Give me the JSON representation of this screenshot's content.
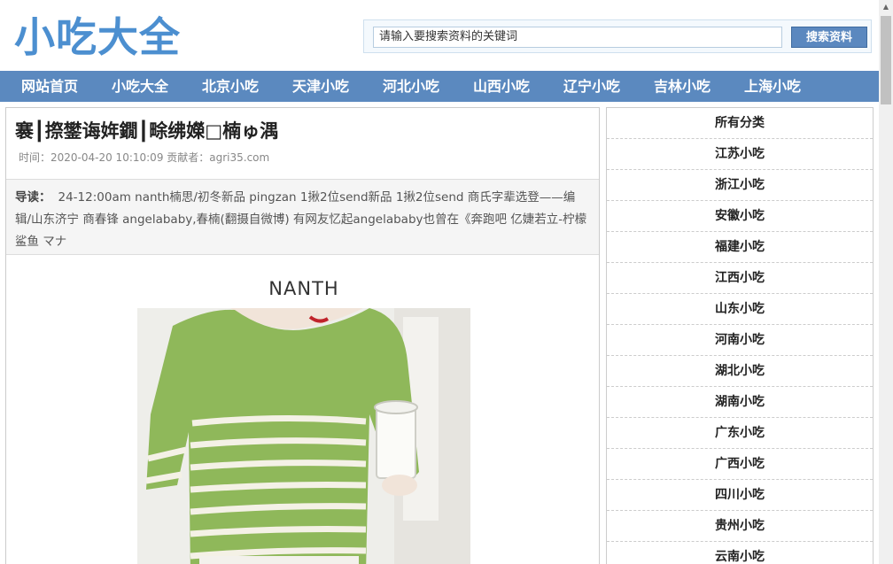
{
  "header": {
    "logo": "小吃大全",
    "search_placeholder": "请输入要搜索资料的关键词",
    "search_button": "搜索资料"
  },
  "nav": [
    "网站首页",
    "小吃大全",
    "北京小吃",
    "天津小吃",
    "河北小吃",
    "山西小吃",
    "辽宁小吃",
    "吉林小吃",
    "上海小吃"
  ],
  "article": {
    "title": "褰┃摖鐢诲姩鐗┃畭绋嬫□楠ゅ湡",
    "meta": "时间：2020-04-20 10:10:09 贡献者：agri35.com",
    "summary_label": "导读：",
    "summary": "24-12:00am nanth楠思/初冬新品 pingzan 1揪2位send新品 1揪2位send 商氏字辈选登——编辑/山东济宁 商春锋 angelababy,春楠(翻摄自微博) 有网友忆起angelababy也曾在《奔跑吧 亿婕若立-柠檬鲨鱼 マナ",
    "image_brand": "NANTH"
  },
  "sidebar": {
    "categories": [
      "所有分类",
      "江苏小吃",
      "浙江小吃",
      "安徽小吃",
      "福建小吃",
      "江西小吃",
      "山东小吃",
      "河南小吃",
      "湖北小吃",
      "湖南小吃",
      "广东小吃",
      "广西小吃",
      "四川小吃",
      "贵州小吃",
      "云南小吃"
    ]
  },
  "colors": {
    "logo": "#4c8fd0",
    "nav_bg": "#5b89bf",
    "search_btn": "#5b88bf",
    "sweater_green": "#8fb85a"
  }
}
